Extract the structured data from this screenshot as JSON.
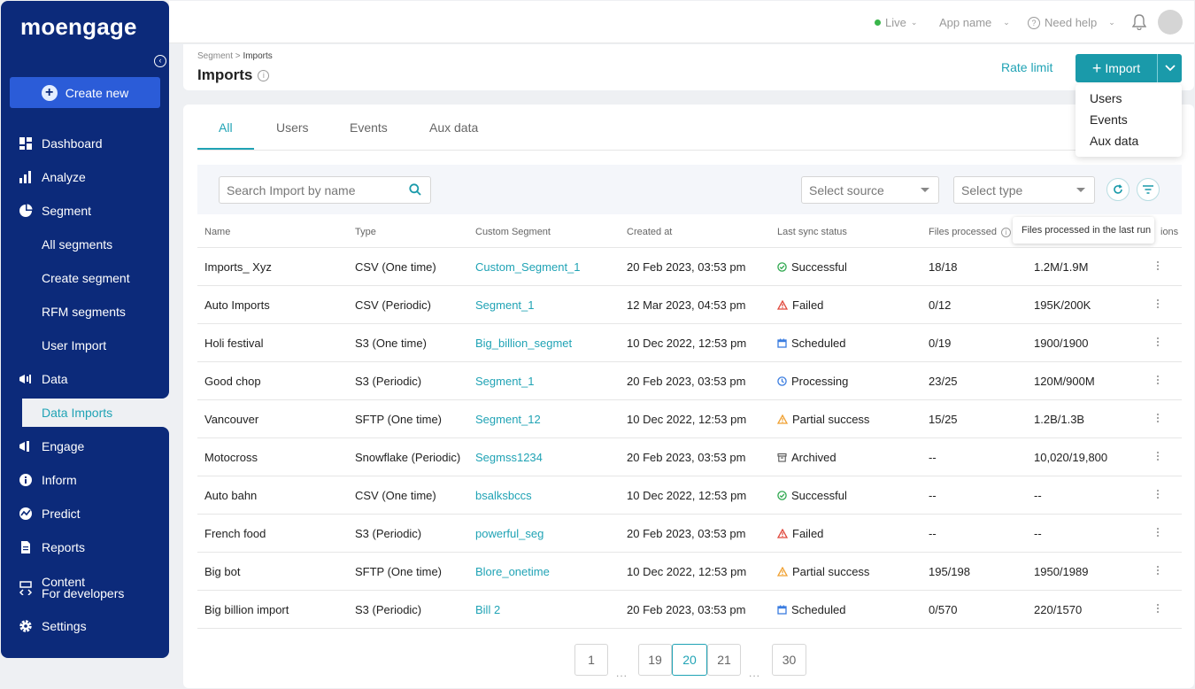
{
  "sidebar": {
    "logo": "moengage",
    "create_new": "Create new",
    "items": [
      {
        "label": "Dashboard",
        "icon": "dashboard-icon"
      },
      {
        "label": "Analyze",
        "icon": "analyze-icon"
      },
      {
        "label": "Segment",
        "icon": "segment-icon"
      },
      {
        "label": "All segments"
      },
      {
        "label": "Create segment"
      },
      {
        "label": "RFM segments"
      },
      {
        "label": "User Import"
      },
      {
        "label": "Data",
        "icon": "data-icon"
      },
      {
        "label": "Data Imports"
      },
      {
        "label": "Engage",
        "icon": "engage-icon"
      },
      {
        "label": "Inform",
        "icon": "inform-icon"
      },
      {
        "label": "Predict",
        "icon": "predict-icon"
      },
      {
        "label": "Reports",
        "icon": "reports-icon"
      },
      {
        "label": "Content",
        "label2": "For developers",
        "icon": "content-icon"
      },
      {
        "label": "Settings",
        "icon": "settings-icon"
      }
    ]
  },
  "topbar": {
    "env": "Live",
    "app": "App name",
    "help": "Need help"
  },
  "header": {
    "breadcrumb_parent": "Segment",
    "breadcrumb_sep": " > ",
    "breadcrumb_current": "Imports",
    "title": "Imports",
    "rate_limit": "Rate limit",
    "import_label": "Import"
  },
  "import_menu": [
    "Users",
    "Events",
    "Aux data"
  ],
  "tabs": [
    "All",
    "Users",
    "Events",
    "Aux data"
  ],
  "filters": {
    "search_placeholder": "Search Import by name",
    "source_placeholder": "Select source",
    "type_placeholder": "Select type"
  },
  "table": {
    "columns": [
      "Name",
      "Type",
      "Custom Segment",
      "Created at",
      "Last sync status",
      "Files processed",
      "",
      "ions"
    ],
    "tooltip": "Files processed in the last run",
    "rows": [
      [
        "Imports_ Xyz",
        "CSV (One time)",
        "Custom_Segment_1",
        "20 Feb 2023, 03:53 pm",
        "Successful",
        "18/18",
        "1.2M/1.9M"
      ],
      [
        "Auto Imports",
        "CSV (Periodic)",
        "Segment_1",
        "12 Mar 2023, 04:53 pm",
        "Failed",
        "0/12",
        "195K/200K"
      ],
      [
        "Holi festival",
        "S3 (One time)",
        "Big_billion_segmet",
        "10 Dec 2022, 12:53 pm",
        "Scheduled",
        "0/19",
        "1900/1900"
      ],
      [
        "Good chop",
        "S3 (Periodic)",
        "Segment_1",
        "20 Feb 2023, 03:53 pm",
        "Processing",
        "23/25",
        "120M/900M"
      ],
      [
        "Vancouver",
        "SFTP (One time)",
        "Segment_12",
        "10 Dec 2022, 12:53 pm",
        "Partial success",
        "15/25",
        "1.2B/1.3B"
      ],
      [
        "Motocross",
        "Snowflake (Periodic)",
        "Segmss1234",
        "20 Feb 2023, 03:53 pm",
        "Archived",
        "--",
        "10,020/19,800"
      ],
      [
        "Auto bahn",
        "CSV (One time)",
        "bsalksbccs",
        "10 Dec 2022, 12:53 pm",
        "Successful",
        "--",
        "--"
      ],
      [
        "French food",
        "S3 (Periodic)",
        "powerful_seg",
        "20 Feb 2023, 03:53 pm",
        "Failed",
        "--",
        "--"
      ],
      [
        "Big bot",
        "SFTP (One time)",
        "Blore_onetime",
        "10 Dec 2022, 12:53 pm",
        "Partial success",
        "195/198",
        "1950/1989"
      ],
      [
        "Big billion import",
        "S3 (Periodic)",
        "Bill 2",
        "20 Feb 2023, 03:53 pm",
        "Scheduled",
        "0/570",
        "220/1570"
      ]
    ]
  },
  "status_colors": {
    "Successful": "#2fa84f",
    "Failed": "#e0483c",
    "Scheduled": "#3b7de0",
    "Processing": "#3b7de0",
    "Partial success": "#f0a030",
    "Archived": "#555555"
  },
  "pagination": {
    "pages": [
      "1",
      "19",
      "20",
      "21",
      "30"
    ],
    "current": "20",
    "ellipsis": "..."
  },
  "colors": {
    "brand_navy": "#0c2a7a",
    "accent_teal": "#20a3b5"
  }
}
